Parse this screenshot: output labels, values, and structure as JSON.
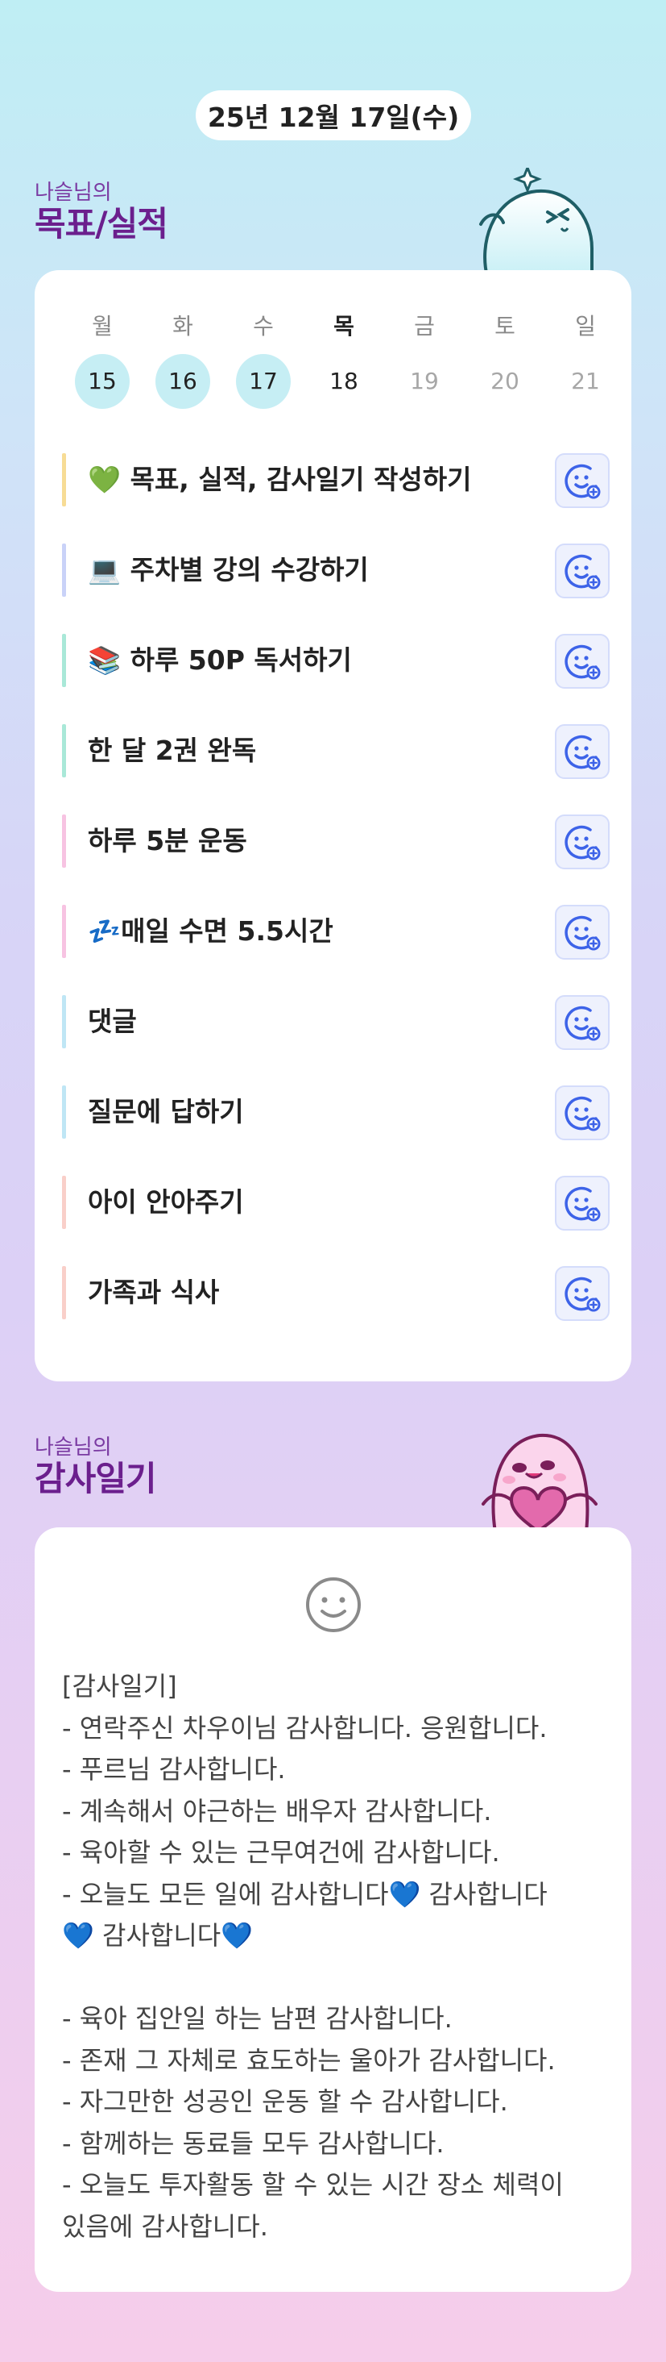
{
  "header": {
    "date": "25년 12월 17일(수)"
  },
  "goals_section": {
    "subtitle": "나슬님의",
    "title": "목표/실적"
  },
  "week": {
    "days": [
      {
        "label": "월",
        "num": "15",
        "state": "done"
      },
      {
        "label": "화",
        "num": "16",
        "state": "done"
      },
      {
        "label": "수",
        "num": "17",
        "state": "done"
      },
      {
        "label": "목",
        "num": "18",
        "state": "today"
      },
      {
        "label": "금",
        "num": "19",
        "state": "future"
      },
      {
        "label": "토",
        "num": "20",
        "state": "future"
      },
      {
        "label": "일",
        "num": "21",
        "state": "future"
      }
    ]
  },
  "goals": [
    {
      "text": "💚 목표, 실적, 감사일기 작성하기",
      "color": "#f7dc95"
    },
    {
      "text": "💻 주차별 강의 수강하기",
      "color": "#c9d2f8"
    },
    {
      "text": "📚 하루 50P 독서하기",
      "color": "#a9e8d8"
    },
    {
      "text": "한 달 2권 완독",
      "color": "#a9e8d8"
    },
    {
      "text": "하루 5분 운동",
      "color": "#f7c3e2"
    },
    {
      "text": "💤매일 수면 5.5시간",
      "color": "#f7c3e2"
    },
    {
      "text": "댓글",
      "color": "#bfe6f5"
    },
    {
      "text": "질문에 답하기",
      "color": "#bfe6f5"
    },
    {
      "text": "아이 안아주기",
      "color": "#f9cfc9"
    },
    {
      "text": "가족과 식사",
      "color": "#f9cfc9"
    }
  ],
  "diary_section": {
    "subtitle": "나슬님의",
    "title": "감사일기"
  },
  "diary": {
    "text": "[감사일기]\n- 연락주신 차우이님 감사합니다. 응원합니다.\n- 푸르님 감사합니다.\n- 계속해서 야근하는 배우자 감사합니다.\n- 육아할 수 있는 근무여건에 감사합니다.\n- 오늘도 모든 일에 감사합니다💙 감사합니다\n💙 감사합니다💙\n\n- 육아 집안일 하는 남편 감사합니다.\n- 존재 그 자체로 효도하는 울아가 감사합니다.\n- 자그만한 성공인 운동 할 수 감사합니다.\n- 함께하는 동료들 모두 감사합니다.\n- 오늘도 투자활동 할 수 있는 시간 장소 체력이\n있음에 감사합니다."
  },
  "colors": {
    "accent": "#6b1f8d",
    "icon_blue": "#3d63e8",
    "done_day": "#c6eef4"
  },
  "icons": {
    "goal_action": "smile-plus-icon",
    "diary_mood": "smile-icon"
  }
}
